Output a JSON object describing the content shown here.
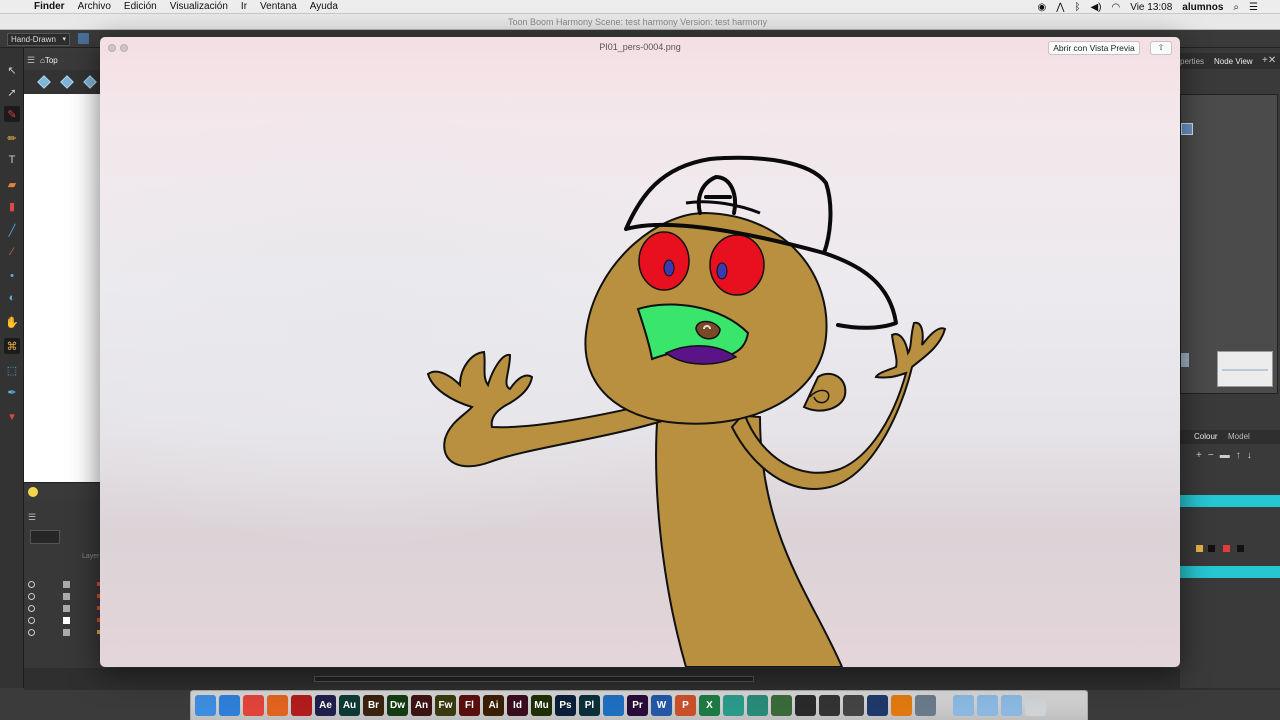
{
  "menubar": {
    "apple_icon": "apple-icon",
    "items": [
      "Finder",
      "Archivo",
      "Edición",
      "Visualización",
      "Ir",
      "Ventana",
      "Ayuda"
    ],
    "clock": "Vie 13:08",
    "user": "alumnos"
  },
  "toonboom": {
    "window_title": "Toon Boom Harmony Scene: test harmony Version: test harmony",
    "mode": "Hand-Drawn",
    "top_view_title": "Top",
    "right_tabs": [
      "perties",
      "Node View"
    ],
    "colour_tabs": [
      "Colour",
      "Model"
    ],
    "layers_header": "Layer"
  },
  "preview": {
    "filename": "PI01_pers-0004.png",
    "open_button": "Abrir con Vista Previa",
    "share_icon": "share-icon"
  },
  "colors": {
    "skin": "#b8903f",
    "eyes": "#e8101f",
    "pupils": "#3a3bb0",
    "mouth": "#39e56b",
    "tongue": "#5a1487",
    "accent_cyan": "#26c6d2"
  },
  "dock": {
    "apps": [
      {
        "name": "finder",
        "label": "",
        "color": "#3f8de0"
      },
      {
        "name": "safari",
        "label": "",
        "color": "#2f7fd8"
      },
      {
        "name": "chrome",
        "label": "",
        "color": "#e0443a"
      },
      {
        "name": "firefox",
        "label": "",
        "color": "#e06420"
      },
      {
        "name": "acrobat",
        "label": "",
        "color": "#b11c1c"
      },
      {
        "name": "after-effects",
        "label": "Ae",
        "color": "#1f1f4c"
      },
      {
        "name": "audition",
        "label": "Au",
        "color": "#0d3b33"
      },
      {
        "name": "bridge",
        "label": "Br",
        "color": "#3a2310"
      },
      {
        "name": "dreamweaver",
        "label": "Dw",
        "color": "#143b14"
      },
      {
        "name": "animate",
        "label": "An",
        "color": "#3d1414"
      },
      {
        "name": "fireworks",
        "label": "Fw",
        "color": "#3a3a10"
      },
      {
        "name": "flash",
        "label": "Fl",
        "color": "#5a0f0f"
      },
      {
        "name": "illustrator",
        "label": "Ai",
        "color": "#3a1f05"
      },
      {
        "name": "indesign",
        "label": "Id",
        "color": "#3a0c1f"
      },
      {
        "name": "muse",
        "label": "Mu",
        "color": "#1f2f05"
      },
      {
        "name": "photoshop",
        "label": "Ps",
        "color": "#0c1f3a"
      },
      {
        "name": "prelude",
        "label": "Pl",
        "color": "#0c2f3a"
      },
      {
        "name": "toon-boom",
        "label": "",
        "color": "#1f6fbf"
      },
      {
        "name": "premiere",
        "label": "Pr",
        "color": "#2a0c3a"
      },
      {
        "name": "word",
        "label": "W",
        "color": "#2457a6"
      },
      {
        "name": "powerpoint",
        "label": "P",
        "color": "#c9512a"
      },
      {
        "name": "excel",
        "label": "X",
        "color": "#1e7a45"
      },
      {
        "name": "storyboard",
        "label": "",
        "color": "#2a9a8a"
      },
      {
        "name": "harmony",
        "label": "",
        "color": "#2a8a7a"
      },
      {
        "name": "sketchup",
        "label": "",
        "color": "#3a6a3a"
      },
      {
        "name": "unity",
        "label": "",
        "color": "#2a2a2a"
      },
      {
        "name": "clapper",
        "label": "",
        "color": "#333333"
      },
      {
        "name": "tools",
        "label": "",
        "color": "#444444"
      },
      {
        "name": "quicktime",
        "label": "",
        "color": "#1f3a6a"
      },
      {
        "name": "vlc",
        "label": "",
        "color": "#e07a10"
      },
      {
        "name": "system-prefs",
        "label": "",
        "color": "#6a7a8a"
      },
      {
        "name": "folder-a",
        "label": "",
        "color": "#8ab8e0"
      },
      {
        "name": "folder-b",
        "label": "",
        "color": "#8ab8e0"
      },
      {
        "name": "downloads",
        "label": "",
        "color": "#8ab8e0"
      },
      {
        "name": "trash",
        "label": "",
        "color": "#cfd3d6"
      }
    ]
  }
}
